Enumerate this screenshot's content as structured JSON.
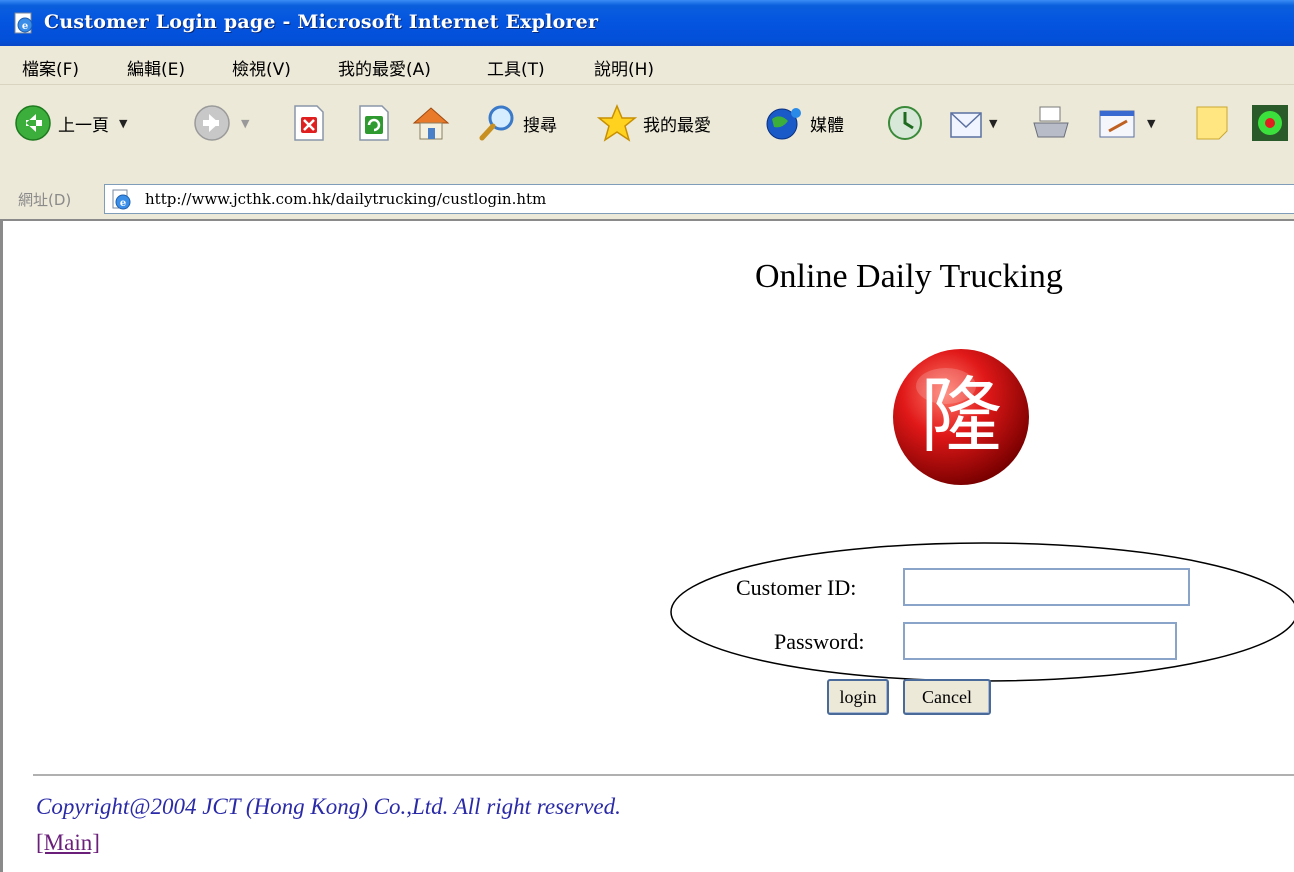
{
  "window": {
    "title": "Customer Login page - Microsoft Internet Explorer"
  },
  "menu": [
    "檔案(F)",
    "編輯(E)",
    "檢視(V)",
    "我的最愛(A)",
    "工具(T)",
    "說明(H)"
  ],
  "toolbar": {
    "back_label": "上一頁",
    "search_label": "搜尋",
    "favorites_label": "我的最愛",
    "media_label": "媒體"
  },
  "address": {
    "label": "網址(D)",
    "url": "http://www.jcthk.com.hk/dailytrucking/custlogin.htm"
  },
  "page": {
    "heading": "Online Daily Trucking",
    "customer_id_label": "Customer ID:",
    "password_label": "Password:",
    "customer_id_value": "",
    "password_value": "",
    "login_label": "login",
    "cancel_label": "Cancel",
    "copyright": "Copyright@2004 JCT (Hong Kong) Co.,Ltd. All right reserved.",
    "main_link": "[Main]",
    "logo_char": "隆"
  },
  "colors": {
    "titlebar": "#0454e0",
    "chrome": "#ece9d8",
    "copyright_text": "#2a2aa8",
    "visited_link": "#6b1f7b",
    "logo_red": "#d81818"
  }
}
